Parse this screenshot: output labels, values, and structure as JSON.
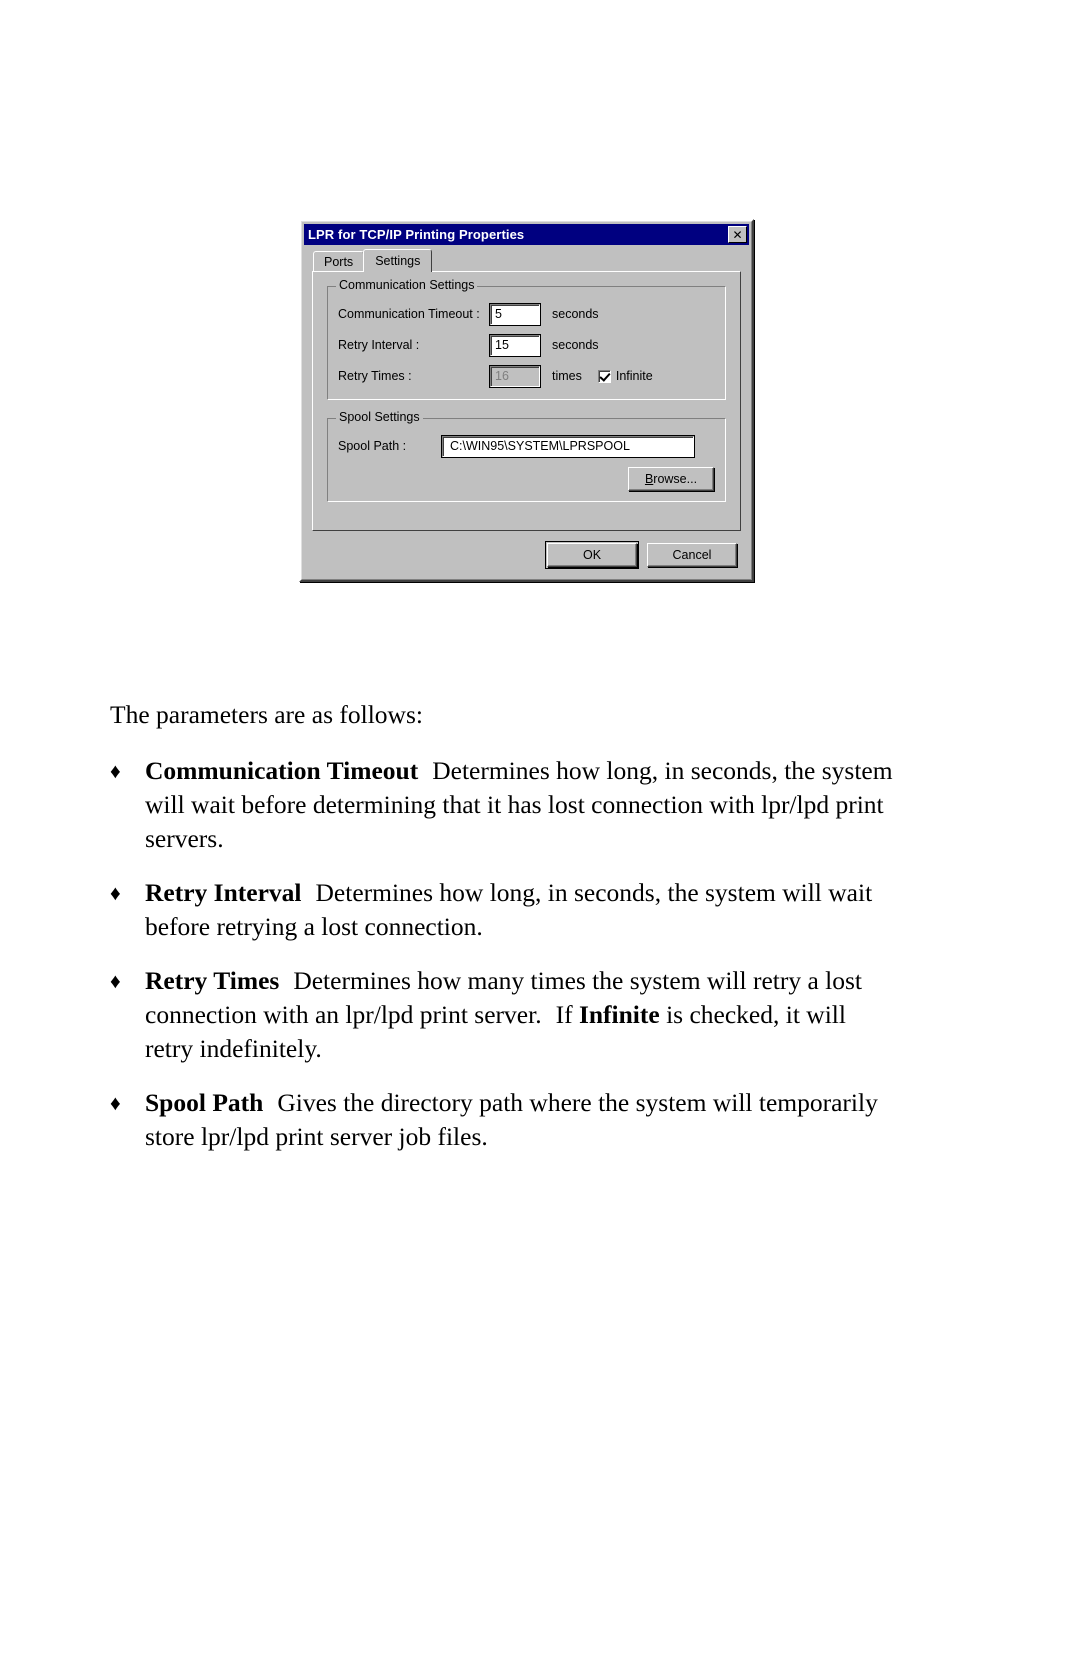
{
  "dialog": {
    "title": "LPR for TCP/IP Printing Properties",
    "close_icon": "✕",
    "tabs": [
      {
        "label": "Ports",
        "active": false
      },
      {
        "label": "Settings",
        "active": true
      }
    ],
    "communication_group": {
      "legend": "Communication Settings",
      "fields": [
        {
          "label": "Communication Timeout :",
          "value": "5",
          "unit": "seconds"
        },
        {
          "label": "Retry Interval :",
          "value": "15",
          "unit": "seconds"
        },
        {
          "label": "Retry Times :",
          "value": "16",
          "unit": "times"
        }
      ],
      "infinite_label": "Infinite",
      "infinite_checked": true
    },
    "spool_group": {
      "legend": "Spool Settings",
      "path_label": "Spool Path :",
      "path_value": "C:\\WIN95\\SYSTEM\\LPRSPOOL",
      "browse_accel": "B",
      "browse_rest": "rowse..."
    },
    "footer": {
      "ok_label": "OK",
      "cancel_label": "Cancel"
    },
    "colors": {
      "titlebar": "#000080",
      "face": "#c0c0c0",
      "disabled_text": "#808080"
    }
  },
  "body": {
    "intro": "The parameters are as follows:",
    "bullet_mark": "♦",
    "items": [
      {
        "term": "Communication Timeout",
        "desc": "Determines how long, in seconds, the system will wait before determining that it has lost connection with lpr/lpd print servers."
      },
      {
        "term": "Retry Interval",
        "desc": "Determines how long, in seconds, the system will wait before retrying a lost connection."
      },
      {
        "term": "Retry Times",
        "desc_part1": "Determines how many times the system will retry a lost connection with an lpr/lpd print server.",
        "desc_if": "If",
        "desc_bold2": "Infinite",
        "desc_part2": "is checked, it will retry indefinitely."
      },
      {
        "term": "Spool Path",
        "desc": "Gives the directory path where the system will temporarily store lpr/lpd print server job files."
      }
    ]
  }
}
